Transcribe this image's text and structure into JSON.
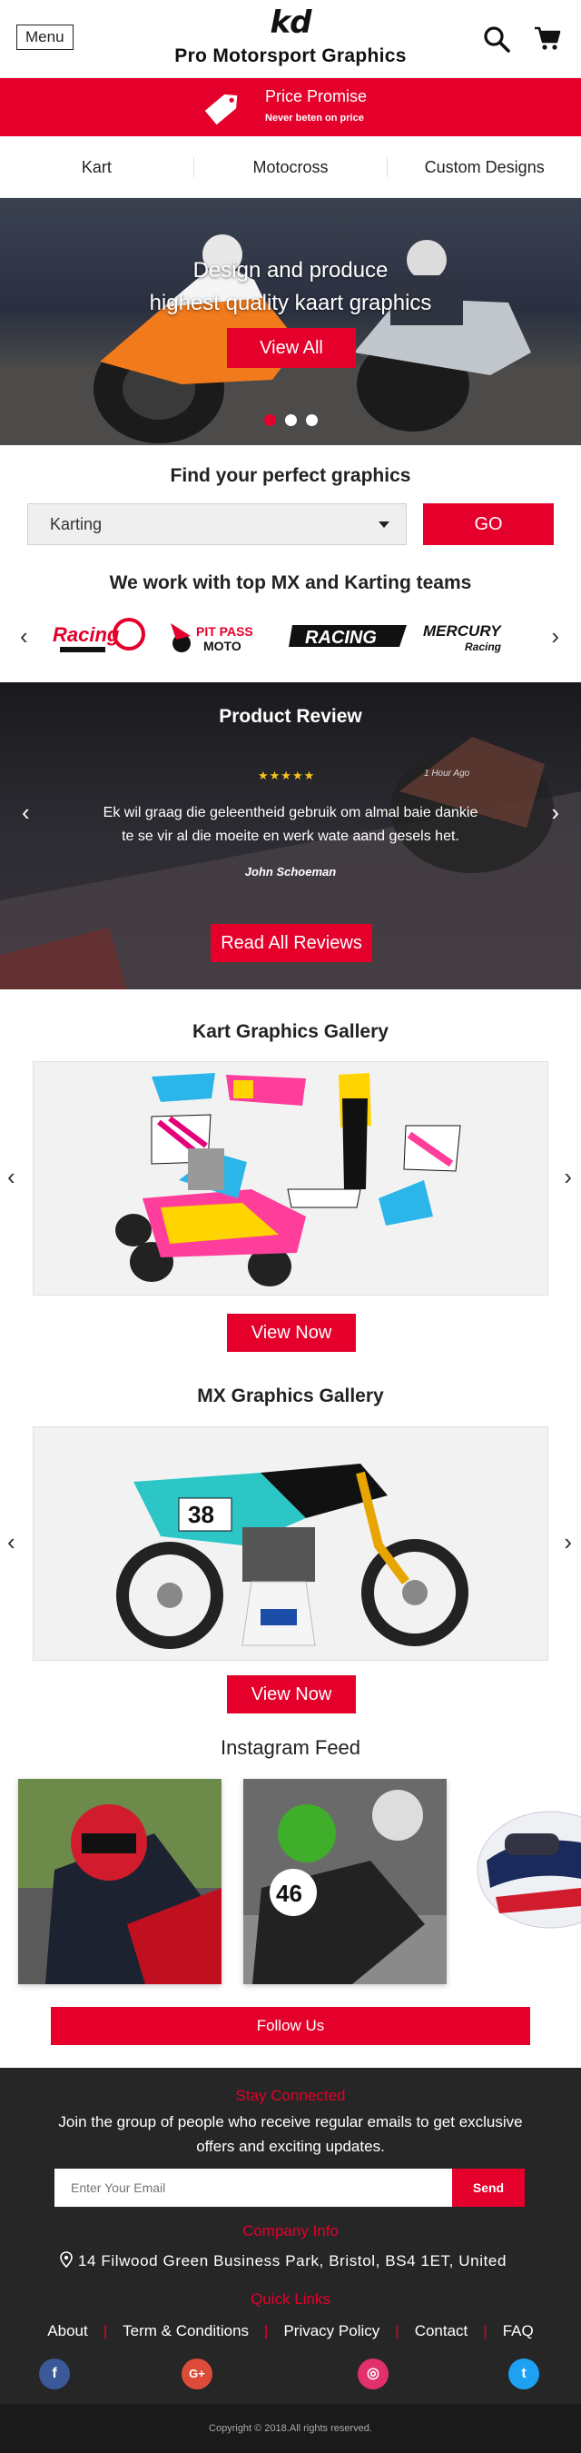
{
  "header": {
    "menu_label": "Menu",
    "logo_text": "kd",
    "brand": "Pro Motorsport Graphics",
    "icons": [
      "search-icon",
      "cart-icon"
    ]
  },
  "promise": {
    "title": "Price Promise",
    "subtitle": "Never beten on price"
  },
  "nav": {
    "items": [
      "Kart",
      "Motocross",
      "Custom Designs"
    ]
  },
  "hero": {
    "title": "Design and produce\nhighest quality kaart graphics",
    "button": "View All",
    "slides": 3,
    "active_slide": 1
  },
  "finder": {
    "title": "Find your perfect graphics",
    "selected": "Karting",
    "go_label": "GO"
  },
  "teams": {
    "title": "We work with top MX and Karting teams",
    "logos": [
      "Racing",
      "PIT PASS MOTO",
      "RACING",
      "MERCURY Racing"
    ]
  },
  "review": {
    "title": "Product Review",
    "rating": 5,
    "stars": "★★★★★",
    "time": "1 Hour Ago",
    "text": "Ek wil graag die geleentheid gebruik om almal baie dankie\nte se vir al die moeite en werk wate aand gesels het.",
    "author": "John Schoeman",
    "button": "Read All Reviews"
  },
  "kart_gallery": {
    "title": "Kart Graphics Gallery",
    "button": "View Now"
  },
  "mx_gallery": {
    "title": "MX Graphics Gallery",
    "button": "View Now",
    "bike_number": "38"
  },
  "instagram": {
    "title": "Instagram Feed",
    "rider_number": "46",
    "button": "Follow Us"
  },
  "footer": {
    "stay_title": "Stay Connected",
    "stay_text": "Join the group of people who receive regular emails to get exclusive offers and exciting updates.",
    "email_placeholder": "Enter Your Email",
    "send_label": "Send",
    "company_title": "Company Info",
    "address": "14 Filwood Green Business Park, Bristol, BS4 1ET, United",
    "links_title": "Quick Links",
    "links": [
      "About",
      "Term & Conditions",
      "Privacy Policy",
      "Contact",
      "FAQ"
    ],
    "socials": [
      {
        "name": "facebook-icon",
        "glyph": "f",
        "color": "#3b5998"
      },
      {
        "name": "google-plus-icon",
        "glyph": "G+",
        "color": "#dd4b39"
      },
      {
        "name": "instagram-icon",
        "glyph": "◎",
        "color": "#e1306c"
      },
      {
        "name": "twitter-icon",
        "glyph": "t",
        "color": "#1da1f2"
      }
    ],
    "copyright": "Copyright © 2018.All rights reserved."
  },
  "colors": {
    "accent": "#e4002b",
    "footer_bg": "#262626",
    "copyright_bg": "#1a1a1a"
  }
}
